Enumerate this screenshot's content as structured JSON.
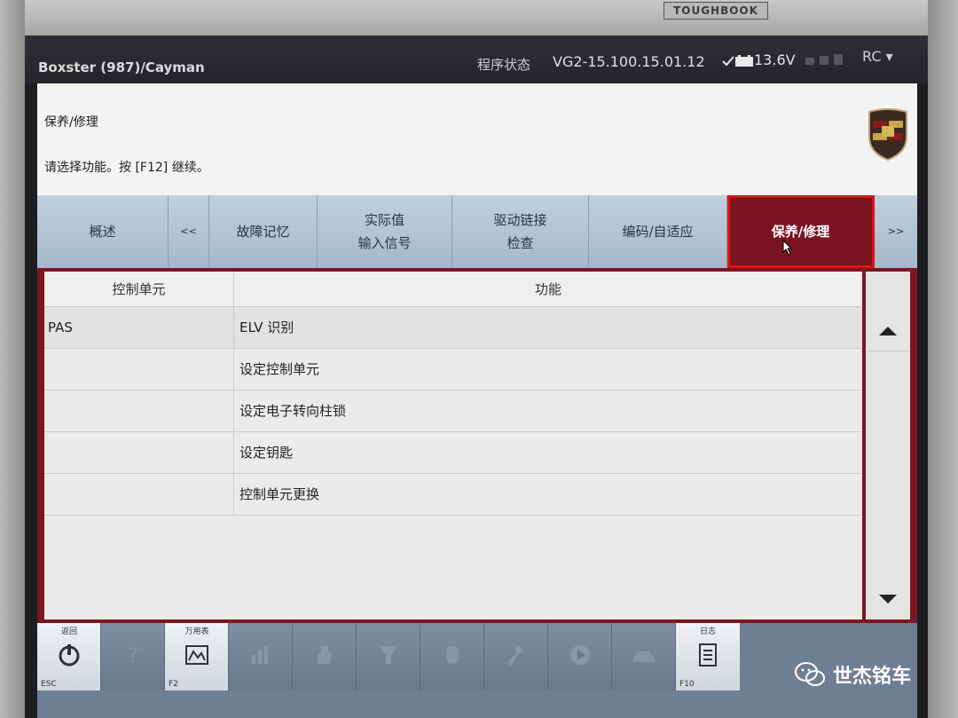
{
  "device": {
    "brand": "TOUGHBOOK"
  },
  "titlebar": {
    "model": "Boxster (987)/Cayman",
    "status_label": "程序状态",
    "version": "VG2-15.100.15.01.12",
    "voltage": "13.6V",
    "rc": "RC ▾"
  },
  "header": {
    "breadcrumb": "保养/修理",
    "instruction": "请选择功能。按 [F12] 继续。"
  },
  "tabs": [
    {
      "label": "概述"
    },
    {
      "label": "<<"
    },
    {
      "label": "故障记忆"
    },
    {
      "label": "实际值",
      "label2": "输入信号"
    },
    {
      "label": "驱动链接",
      "label2": "检查"
    },
    {
      "label": "编码/自适应"
    },
    {
      "label": "保养/修理",
      "active": true
    },
    {
      "label": ">>"
    }
  ],
  "table": {
    "columns": [
      "控制单元",
      "功能"
    ],
    "rows": [
      {
        "unit": "PAS",
        "function": "ELV 识别"
      },
      {
        "unit": "",
        "function": "设定控制单元"
      },
      {
        "unit": "",
        "function": "设定电子转向柱锁"
      },
      {
        "unit": "",
        "function": "设定钥匙"
      },
      {
        "unit": "",
        "function": "控制单元更换"
      }
    ]
  },
  "toolbar": {
    "items": [
      {
        "label": "返回",
        "fkey": "ESC",
        "icon": "power-icon",
        "enabled": true
      },
      {
        "label": "",
        "fkey": "",
        "icon": "help-icon",
        "enabled": false
      },
      {
        "label": "万用表",
        "fkey": "F2",
        "icon": "multimeter-icon",
        "enabled": true
      },
      {
        "label": "",
        "fkey": "",
        "icon": "chart-icon",
        "enabled": false
      },
      {
        "label": "",
        "fkey": "",
        "icon": "hand-icon",
        "enabled": false
      },
      {
        "label": "",
        "fkey": "",
        "icon": "filter-icon",
        "enabled": false
      },
      {
        "label": "",
        "fkey": "",
        "icon": "tool-icon",
        "enabled": false
      },
      {
        "label": "",
        "fkey": "",
        "icon": "wrench-icon",
        "enabled": false
      },
      {
        "label": "",
        "fkey": "",
        "icon": "play-icon",
        "enabled": false
      },
      {
        "label": "",
        "fkey": "",
        "icon": "car-icon",
        "enabled": false
      },
      {
        "label": "日志",
        "fkey": "F10",
        "icon": "log-icon",
        "enabled": true
      }
    ]
  },
  "watermark": {
    "text": "世杰铭车"
  },
  "colors": {
    "active_tab": "#7a1420",
    "highlight_border": "#e01010",
    "tab_bg": "#b3c4d6"
  }
}
